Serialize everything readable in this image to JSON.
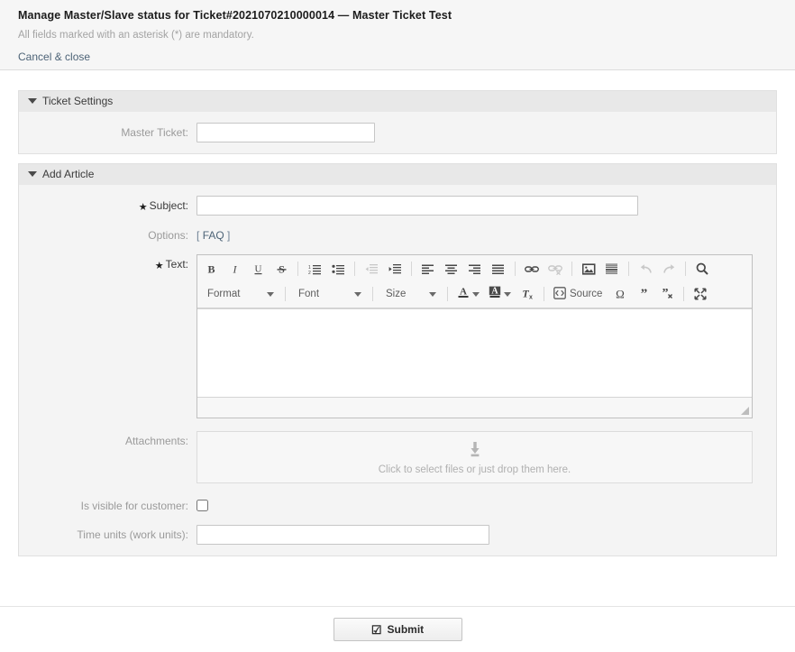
{
  "header": {
    "title": "Manage Master/Slave status for Ticket#2021070210000014 — Master Ticket Test",
    "subtitle": "All fields marked with an asterisk (*) are mandatory.",
    "cancel_label": "Cancel & close"
  },
  "ticket_settings": {
    "section_title": "Ticket Settings",
    "master_ticket_label": "Master Ticket:",
    "master_ticket_value": "",
    "master_ticket_placeholder": ""
  },
  "add_article": {
    "section_title": "Add Article",
    "subject_label": "Subject:",
    "subject_value": "",
    "subject_placeholder": "",
    "options_label": "Options:",
    "options_open_bracket": "[",
    "options_faq_link": "FAQ",
    "options_close_bracket": "]",
    "text_label": "Text:",
    "text_value": "",
    "attachments_label": "Attachments:",
    "dropzone_text": "Click to select files or just drop them here.",
    "visible_for_customer_label": "Is visible for customer:",
    "visible_for_customer_checked": false,
    "time_units_label": "Time units (work units):",
    "time_units_value": "",
    "time_units_placeholder": ""
  },
  "editor_toolbar": {
    "row1": [
      {
        "name": "bold-icon",
        "title": "Bold",
        "disabled": false
      },
      {
        "name": "italic-icon",
        "title": "Italic",
        "disabled": false
      },
      {
        "name": "underline-icon",
        "title": "Underline",
        "disabled": false
      },
      {
        "name": "strikethrough-icon",
        "title": "Strike Through",
        "disabled": false
      },
      {
        "name": "separator",
        "title": "",
        "disabled": false
      },
      {
        "name": "numbered-list-icon",
        "title": "Insert/Remove Numbered List",
        "disabled": false
      },
      {
        "name": "bulleted-list-icon",
        "title": "Insert/Remove Bulleted List",
        "disabled": false
      },
      {
        "name": "separator",
        "title": "",
        "disabled": false
      },
      {
        "name": "decrease-indent-icon",
        "title": "Decrease Indent",
        "disabled": true
      },
      {
        "name": "increase-indent-icon",
        "title": "Increase Indent",
        "disabled": false
      },
      {
        "name": "separator",
        "title": "",
        "disabled": false
      },
      {
        "name": "align-left-icon",
        "title": "Align Left",
        "disabled": false
      },
      {
        "name": "align-center-icon",
        "title": "Center",
        "disabled": false
      },
      {
        "name": "align-right-icon",
        "title": "Align Right",
        "disabled": false
      },
      {
        "name": "justify-icon",
        "title": "Justify",
        "disabled": false
      },
      {
        "name": "separator",
        "title": "",
        "disabled": false
      },
      {
        "name": "link-icon",
        "title": "Link",
        "disabled": false
      },
      {
        "name": "unlink-icon",
        "title": "Unlink",
        "disabled": true
      },
      {
        "name": "separator",
        "title": "",
        "disabled": false
      },
      {
        "name": "image-icon",
        "title": "Image",
        "disabled": false
      },
      {
        "name": "page-break-icon",
        "title": "Page Break",
        "disabled": false
      },
      {
        "name": "separator",
        "title": "",
        "disabled": false
      },
      {
        "name": "undo-icon",
        "title": "Undo",
        "disabled": true
      },
      {
        "name": "redo-icon",
        "title": "Redo",
        "disabled": true
      },
      {
        "name": "separator",
        "title": "",
        "disabled": false
      },
      {
        "name": "find-icon",
        "title": "Find",
        "disabled": false
      }
    ],
    "format_label": "Format",
    "font_label": "Font",
    "size_label": "Size",
    "source_label": "Source",
    "row2_icons": [
      {
        "name": "text-color-icon",
        "title": "Text Color"
      },
      {
        "name": "background-color-icon",
        "title": "Background Color"
      },
      {
        "name": "remove-format-icon",
        "title": "Remove Format"
      },
      {
        "name": "special-character-icon",
        "title": "Insert Special Character"
      },
      {
        "name": "blockquote-icon",
        "title": "Block Quote"
      },
      {
        "name": "remove-quote-icon",
        "title": "Remove Quote"
      },
      {
        "name": "maximize-icon",
        "title": "Maximize"
      }
    ]
  },
  "footer": {
    "submit_label": "Submit",
    "submit_check_glyph": "☑"
  },
  "colors": {
    "header_bg": "#f6f6f6",
    "widget_header_bg": "#e8e8e8",
    "widget_body_bg": "#f4f4f4",
    "link": "#4d6377",
    "label": "#9a9a9a"
  }
}
